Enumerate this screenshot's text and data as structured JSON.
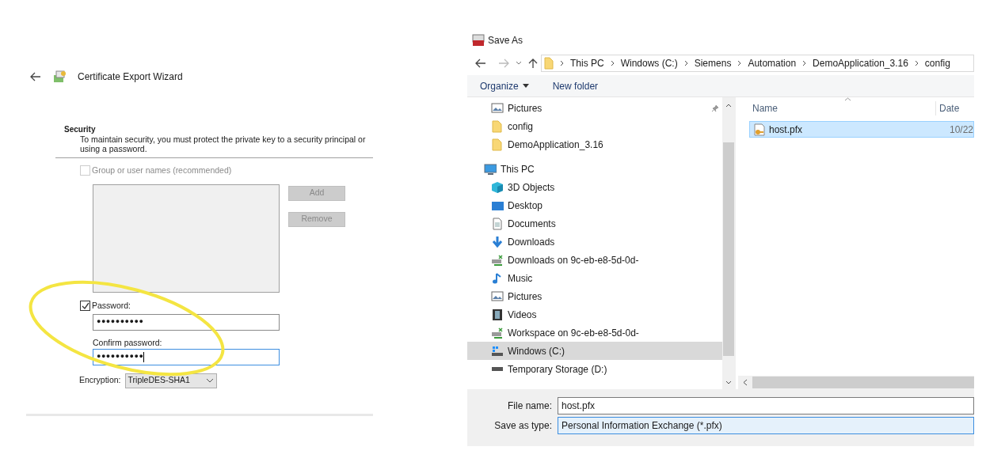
{
  "wizard": {
    "title": "Certificate Export Wizard",
    "section_title": "Security",
    "description": "To maintain security, you must protect the private key to a security principal or using a password.",
    "group_option": {
      "label": "Group or user names (recommended)",
      "checked": false,
      "disabled": true
    },
    "buttons": [
      {
        "label": "Add",
        "disabled": true
      },
      {
        "label": "Remove",
        "disabled": true
      }
    ],
    "password_option": {
      "label": "Password:",
      "checked": true
    },
    "password": {
      "value": "●●●●●●●●●●",
      "focused": false
    },
    "confirm_label": "Confirm password:",
    "confirm_password": {
      "value": "●●●●●●●●●●",
      "focused": true
    },
    "encryption": {
      "label": "Encryption:",
      "value": "TripleDES-SHA1"
    }
  },
  "save_dialog": {
    "title": "Save As",
    "breadcrumb": [
      "This PC",
      "Windows (C:)",
      "Siemens",
      "Automation",
      "DemoApplication_3.16",
      "config"
    ],
    "toolbar": [
      "Organize",
      "New folder"
    ],
    "nav_items": [
      {
        "label": "Pictures",
        "kind": "pictures",
        "pinned": true,
        "selected": false
      },
      {
        "label": "config",
        "kind": "folder",
        "pinned": false,
        "selected": false
      },
      {
        "label": "DemoApplication_3.16",
        "kind": "folder",
        "pinned": false,
        "selected": false
      },
      {
        "label": "This PC",
        "kind": "computer",
        "pinned": false,
        "selected": false,
        "children": [
          {
            "label": "3D Objects",
            "kind": "cube",
            "selected": false
          },
          {
            "label": "Desktop",
            "kind": "desktop",
            "selected": false
          },
          {
            "label": "Documents",
            "kind": "document",
            "selected": false
          },
          {
            "label": "Downloads",
            "kind": "download",
            "selected": false
          },
          {
            "label": "Downloads on 9c-eb-e8-5d-0d-",
            "kind": "network",
            "selected": false
          },
          {
            "label": "Music",
            "kind": "music",
            "selected": false
          },
          {
            "label": "Pictures",
            "kind": "pictures",
            "selected": false
          },
          {
            "label": "Videos",
            "kind": "video",
            "selected": false
          },
          {
            "label": "Workspace on 9c-eb-e8-5d-0d-",
            "kind": "network",
            "selected": false
          },
          {
            "label": "Windows (C:)",
            "kind": "windows-drive",
            "selected": true
          },
          {
            "label": "Temporary Storage (D:)",
            "kind": "drive",
            "selected": false
          }
        ]
      }
    ],
    "columns": [
      "Name",
      "Date"
    ],
    "files": [
      {
        "name": "host.pfx",
        "date": "10/22",
        "selected": true
      }
    ],
    "file_name": {
      "label": "File name:",
      "value": "host.pfx"
    },
    "save_as_type": {
      "label": "Save as type:",
      "value": "Personal Information Exchange (*.pfx)"
    }
  }
}
